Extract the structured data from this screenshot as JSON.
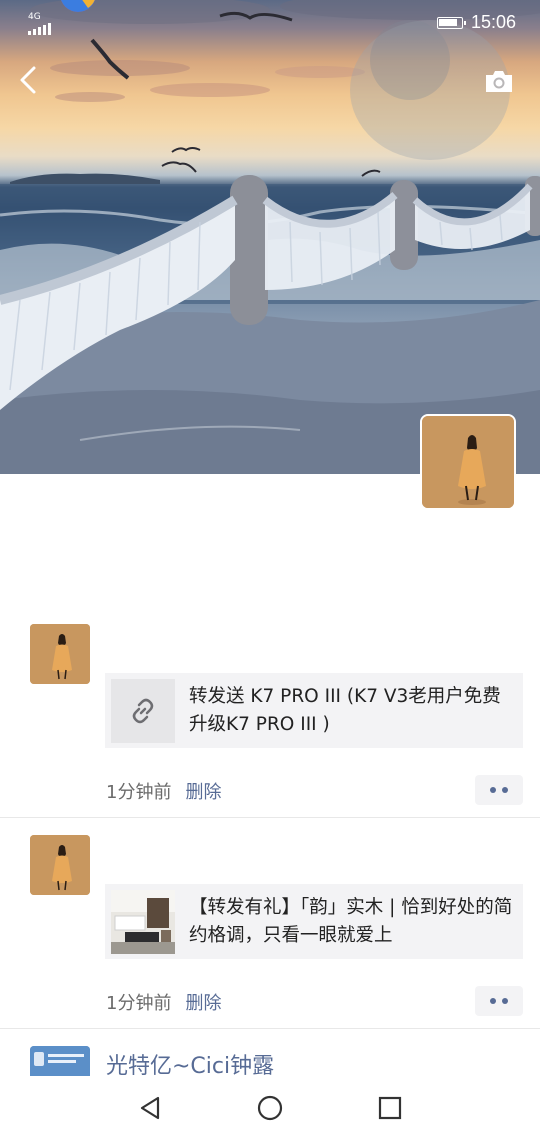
{
  "status_bar": {
    "signal_text": "4G",
    "time": "15:06",
    "icons": [
      "signal-icon",
      "battery-icon"
    ]
  },
  "header": {
    "back_icon": "chevron-left-icon",
    "camera_icon": "camera-icon"
  },
  "posts": [
    {
      "link_text": "转发送 K7 PRO III (K7 V3老用户免费升级K7 PRO III )",
      "link_icon": "link-icon",
      "time": "1分钟前",
      "delete_label": "删除"
    },
    {
      "link_text": "【转发有礼】「韵」实木 | 恰到好处的简约格调，只看一眼就爱上",
      "link_icon": "furniture-thumbnail",
      "time": "1分钟前",
      "delete_label": "删除"
    }
  ],
  "next_post": {
    "name": "光特亿~Cici钟露"
  },
  "colors": {
    "link_blue": "#576b95",
    "card_bg": "#f3f3f5",
    "meta_gray": "#6b6b6b"
  },
  "navbar": {
    "icons": [
      "back-triangle-icon",
      "home-circle-icon",
      "recents-square-icon"
    ]
  }
}
